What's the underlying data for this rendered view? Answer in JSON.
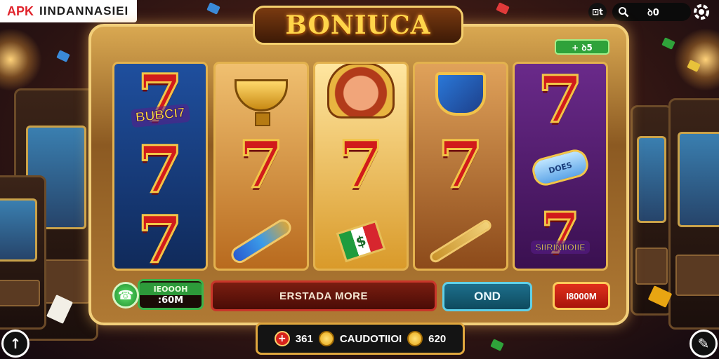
{
  "brand": {
    "apk": "APK",
    "site": "IINDANNASIEI"
  },
  "topbar": {
    "left_btn": "⊡t",
    "search_value": "ꝺ0",
    "icons": [
      "search-icon",
      "settings-icon"
    ]
  },
  "logo": "BONIUCA",
  "win_badge": "+ ꝺ5",
  "reels": [
    {
      "symbols": [
        "7",
        "BUBCI7",
        "7",
        "7"
      ]
    },
    {
      "symbols": [
        "cup",
        "7",
        "tube"
      ]
    },
    {
      "symbols": [
        "face",
        "7",
        "$"
      ]
    },
    {
      "symbols": [
        "shield",
        "7",
        "scepter"
      ]
    },
    {
      "symbols": [
        "7",
        "DOES",
        "SIIRINIIOIIE"
      ]
    }
  ],
  "balance": {
    "top": "IEOOOH",
    "bottom": ":60M"
  },
  "status_text": "ERSTADA MORE",
  "spin_label": "OND",
  "bet_label": "I8000M",
  "tray": {
    "left": "361",
    "center": "CAUDOTIIOI",
    "right": "620"
  },
  "colors": {
    "accent": "#e3b24e",
    "spin": "#1d6f8c",
    "bet": "#e0301c",
    "win": "#2fa23a"
  }
}
